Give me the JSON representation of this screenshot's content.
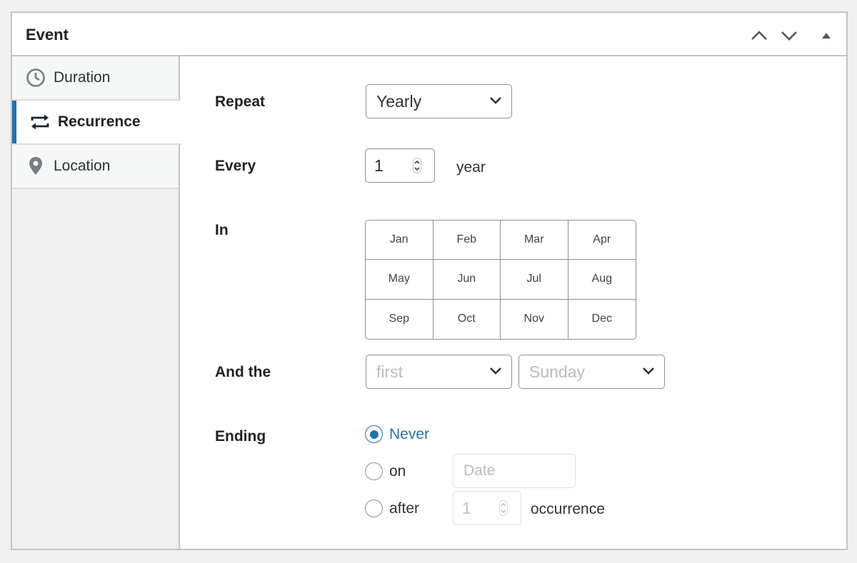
{
  "panel": {
    "title": "Event",
    "header_buttons": [
      "chevron-up-icon",
      "chevron-down-icon",
      "triangle-up-icon"
    ]
  },
  "tabs": [
    {
      "label": "Duration",
      "icon": "clock-icon",
      "active": false
    },
    {
      "label": "Recurrence",
      "icon": "repeat-icon",
      "active": true
    },
    {
      "label": "Location",
      "icon": "map-pin-icon",
      "active": false
    }
  ],
  "form": {
    "repeat": {
      "label": "Repeat",
      "value": "Yearly"
    },
    "every": {
      "label": "Every",
      "value": "1",
      "unit": "year"
    },
    "in": {
      "label": "In",
      "months": [
        "Jan",
        "Feb",
        "Mar",
        "Apr",
        "May",
        "Jun",
        "Jul",
        "Aug",
        "Sep",
        "Oct",
        "Nov",
        "Dec"
      ]
    },
    "and_the": {
      "label": "And the",
      "ordinal_placeholder": "first",
      "weekday_placeholder": "Sunday"
    },
    "ending": {
      "label": "Ending",
      "options": [
        {
          "label": "Never",
          "checked": true
        },
        {
          "label": "on",
          "checked": false
        },
        {
          "label": "after",
          "checked": false
        }
      ],
      "date_placeholder": "Date",
      "occurrence_value": "1",
      "occurrence_unit": "occurrence"
    }
  },
  "colors": {
    "accent": "#2271b1",
    "border": "#8c8f94",
    "sidebar_bg": "#f0f0f1"
  }
}
